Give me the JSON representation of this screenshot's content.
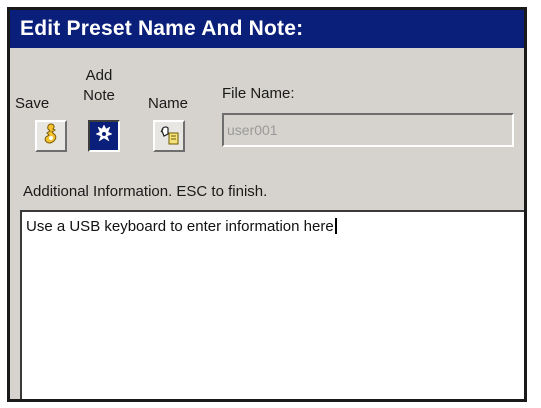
{
  "dialog": {
    "title": "Edit Preset Name And Note:"
  },
  "toolbar": {
    "save_label": "Save",
    "add_note_label_line1": "Add",
    "add_note_label_line2": "Note",
    "name_label": "Name",
    "save_icon": "save-icon",
    "add_note_icon": "add-note-icon",
    "name_icon": "name-icon",
    "active_button": "add_note"
  },
  "file_name": {
    "label": "File Name:",
    "value": "user001"
  },
  "additional_info": {
    "label": "Additional Information. ESC to finish.",
    "text": "Use a USB keyboard to enter information here"
  },
  "colors": {
    "title_bar": "#0a1f7a",
    "panel_bg": "#d6d3ce",
    "active_button": "#0a1f7a"
  }
}
